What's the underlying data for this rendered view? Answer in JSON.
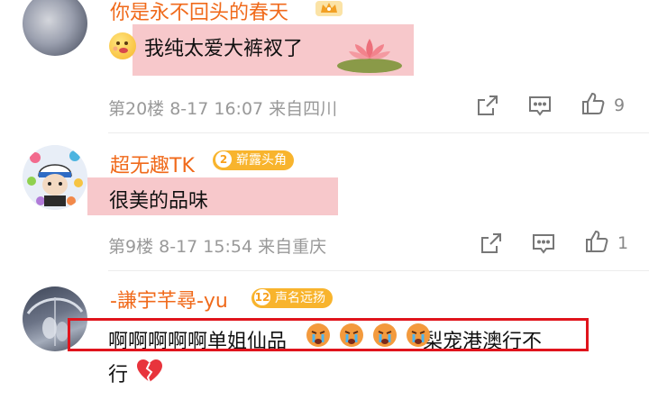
{
  "comments": [
    {
      "username": "你是永不回头的春天",
      "text": "我纯太爱大裤衩了",
      "meta": "第20楼 8-17 16:07 来自四川",
      "like_count": "9"
    },
    {
      "username": "超无趣TK",
      "badge_num": "2",
      "badge_text": "崭露头角",
      "text": "很美的品味",
      "meta": "第9楼 8-17 15:54 来自重庆",
      "like_count": "1"
    },
    {
      "username": "-謙宇芊尋-yu",
      "badge_num": "12",
      "badge_text": "声名远扬",
      "text_part1": "啊啊啊啊啊单姐仙品",
      "text_part2": "梨宠港澳行",
      "text_part3": "不",
      "text_line2": "行"
    }
  ],
  "colors": {
    "username": "#f06a1b",
    "highlight": "#f7c8cb",
    "badge": "#f8b42d",
    "redbox": "#e0141c",
    "meta": "#999999"
  }
}
